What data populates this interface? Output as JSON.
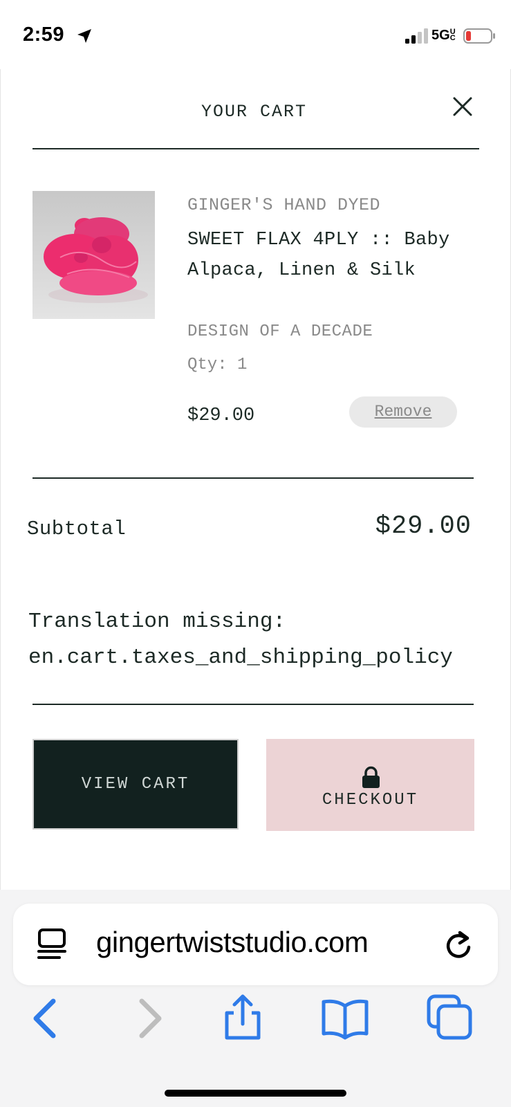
{
  "status_bar": {
    "time": "2:59",
    "network": "5G",
    "network_sub": "UC"
  },
  "cart": {
    "title": "YOUR CART",
    "item": {
      "vendor": "GINGER'S HAND DYED",
      "name": "SWEET FLAX 4PLY :: Baby Alpaca, Linen & Silk",
      "variant": "DESIGN OF A DECADE",
      "qty": "Qty: 1",
      "price": "$29.00",
      "remove_label": "Remove"
    },
    "subtotal_label": "Subtotal",
    "subtotal_value": "$29.00",
    "note_line1": "Translation missing:",
    "note_line2": "en.cart.taxes_and_shipping_policy",
    "view_cart_label": "VIEW CART",
    "checkout_label": "CHECKOUT"
  },
  "browser": {
    "url": "gingertwiststudio.com",
    "accent": "#2f7be8"
  },
  "colors": {
    "dark": "#12211f",
    "checkout_bg": "#ecd3d5",
    "yarn": "#e8306f"
  }
}
